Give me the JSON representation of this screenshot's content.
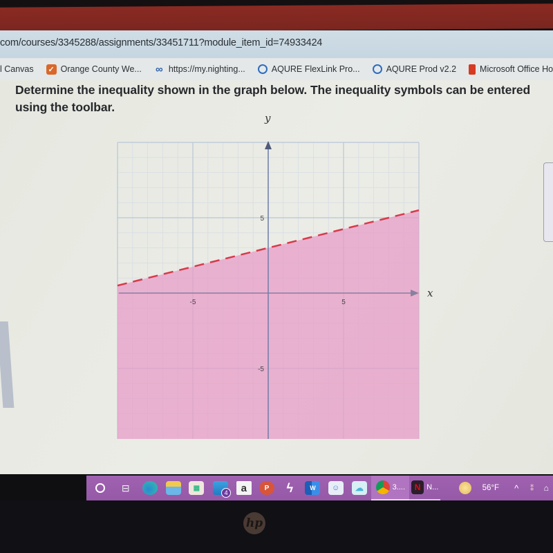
{
  "browser": {
    "url": "com/courses/3345288/assignments/33451711?module_item_id=74933424",
    "bookmarks": [
      {
        "label": "l Canvas",
        "icon": "canvas-icon"
      },
      {
        "label": "Orange County We...",
        "icon": "orange-county-icon"
      },
      {
        "label": "https://my.nighting...",
        "icon": "nightingale-icon"
      },
      {
        "label": "AQURE FlexLink Pro...",
        "icon": "aqure-icon"
      },
      {
        "label": "AQURE Prod v2.2",
        "icon": "aqure-icon"
      },
      {
        "label": "Microsoft Office Ho...",
        "icon": "office-icon"
      }
    ]
  },
  "question": {
    "text": "Determine the inequality shown in the graph below. The inequality symbols can be entered using the toolbar."
  },
  "chart_data": {
    "type": "line",
    "title": "",
    "xlabel": "x",
    "ylabel": "y",
    "xlim": [
      -10,
      10
    ],
    "ylim": [
      -10,
      10
    ],
    "grid": true,
    "x_ticks": [
      {
        "value": -5,
        "label": "-5"
      },
      {
        "value": 5,
        "label": "5"
      }
    ],
    "y_ticks": [
      {
        "value": 5,
        "label": "5"
      },
      {
        "value": -5,
        "label": "-5"
      }
    ],
    "series": [
      {
        "name": "boundary",
        "equation": "y = (1/4)x + 3",
        "slope": 0.25,
        "intercept": 3,
        "style": "dashed",
        "color": "#d8394a",
        "x": [
          -10,
          10
        ],
        "y": [
          0.5,
          5.5
        ]
      }
    ],
    "shading": {
      "region": "below",
      "color": "#e79ac6",
      "inequality": "y < (1/4)x + 3"
    }
  },
  "taskbar": {
    "items": [
      {
        "name": "search",
        "icon": "cortana-circle-icon",
        "label": ""
      },
      {
        "name": "task-view",
        "icon": "task-view-icon",
        "label": ""
      },
      {
        "name": "edge",
        "icon": "edge-icon",
        "label": ""
      },
      {
        "name": "file-explorer",
        "icon": "folder-icon",
        "label": ""
      },
      {
        "name": "store",
        "icon": "store-icon",
        "label": ""
      },
      {
        "name": "mail",
        "icon": "mail-icon",
        "label": "",
        "badge": "4"
      },
      {
        "name": "amazon",
        "icon": "amazon-icon",
        "label": "a"
      },
      {
        "name": "powerpoint",
        "icon": "powerpoint-icon",
        "label": "P"
      },
      {
        "name": "power-automate",
        "icon": "bolt-icon",
        "label": ""
      },
      {
        "name": "word",
        "icon": "word-icon",
        "label": "W"
      },
      {
        "name": "photos",
        "icon": "photos-icon",
        "label": ""
      },
      {
        "name": "onedrive",
        "icon": "cloud-icon",
        "label": ""
      },
      {
        "name": "chrome",
        "icon": "chrome-icon",
        "label": "3...."
      },
      {
        "name": "netflix",
        "icon": "netflix-icon",
        "label": "N..."
      }
    ],
    "weather": "56°F",
    "netflix_letter": "N"
  },
  "hardware": {
    "brand": "hp"
  }
}
